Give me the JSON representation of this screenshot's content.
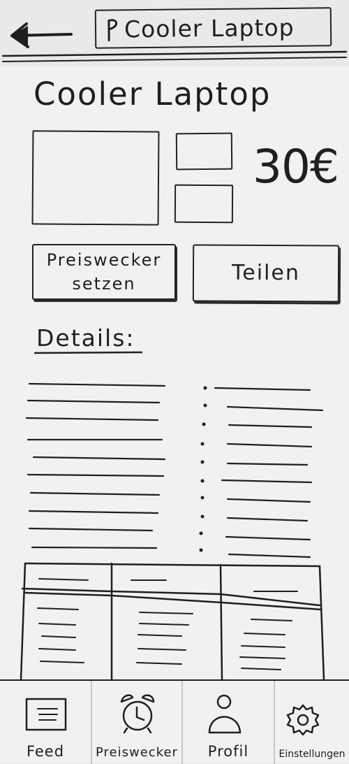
{
  "header": {
    "search_value": "Cooler Laptop"
  },
  "product": {
    "title": "Cooler Laptop",
    "price": "30€"
  },
  "actions": {
    "price_alert_line1": "Preiswecker",
    "price_alert_line2": "setzen",
    "share": "Teilen"
  },
  "details": {
    "heading": "Details:"
  },
  "nav": {
    "items": [
      {
        "label": "Feed",
        "icon": "feed-icon"
      },
      {
        "label": "Preiswecker",
        "icon": "alarm-clock-icon"
      },
      {
        "label": "Profil",
        "icon": "person-icon"
      },
      {
        "label": "Einstellungen",
        "icon": "gear-icon"
      }
    ]
  }
}
